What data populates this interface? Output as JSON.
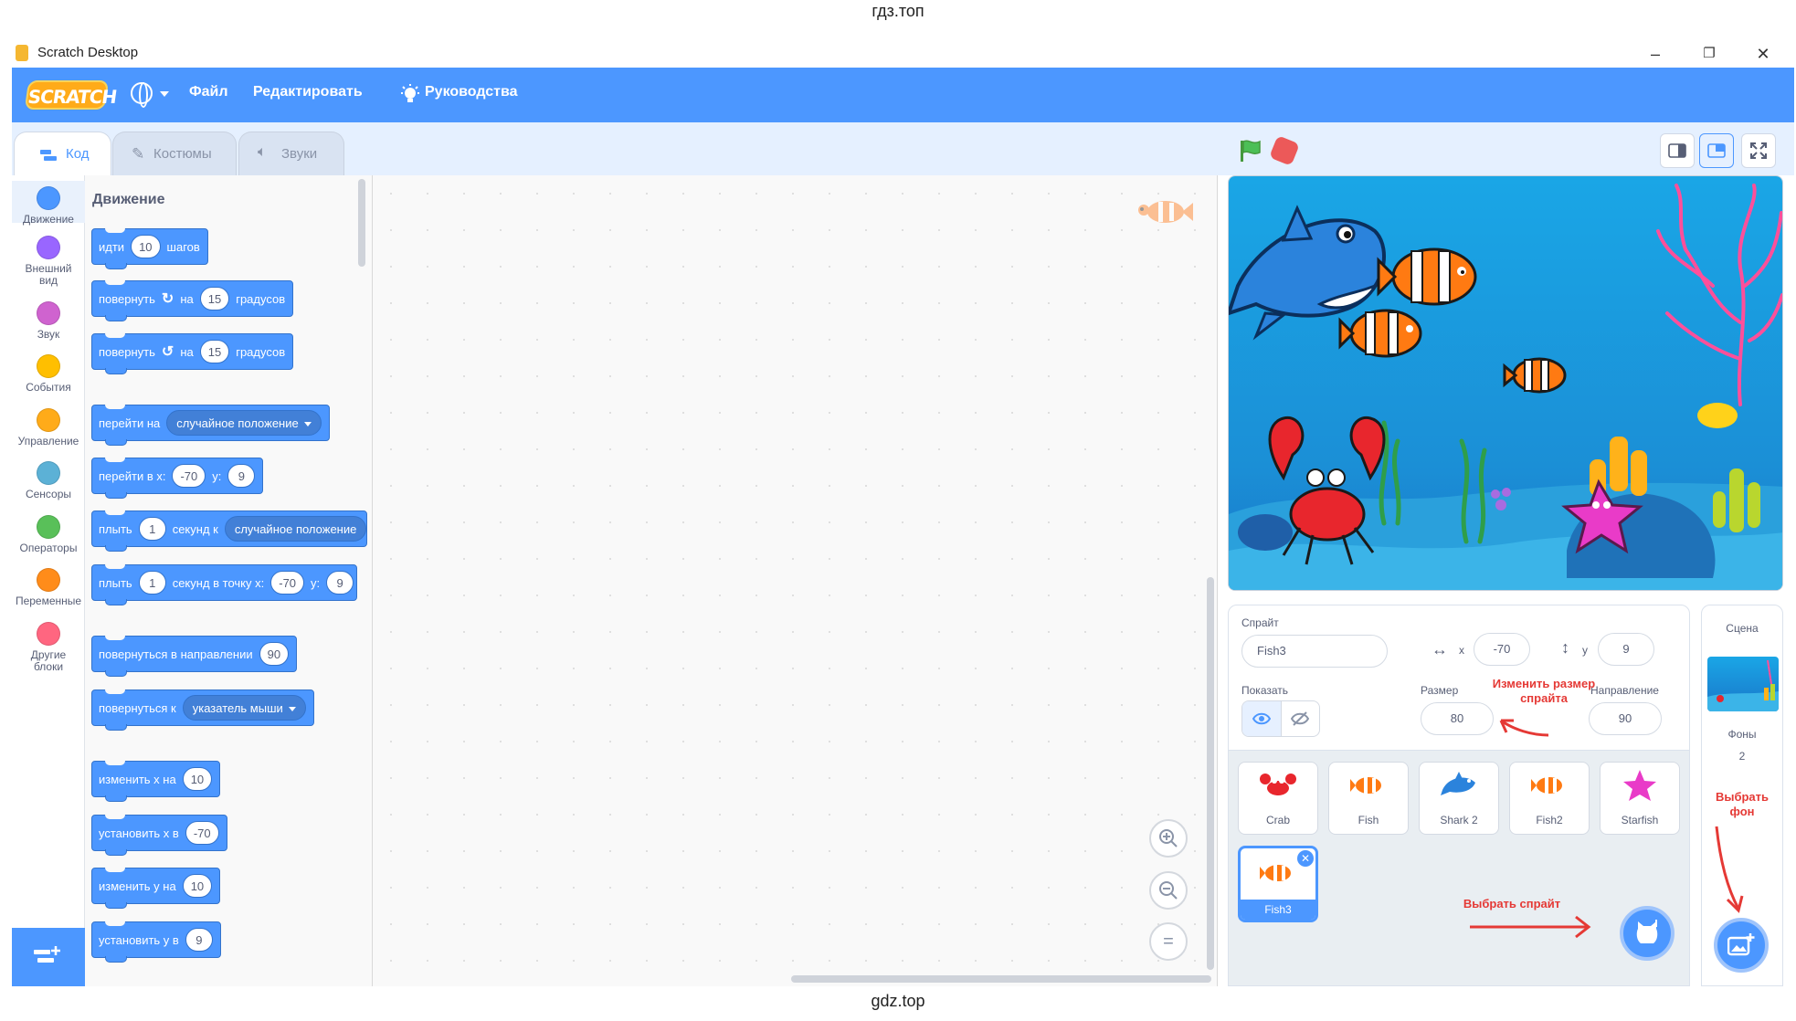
{
  "watermark_top": "гдз.топ",
  "watermark_bottom": "gdz.top",
  "window": {
    "title": "Scratch Desktop",
    "minimize": "–",
    "maximize": "❐",
    "close": "✕"
  },
  "menubar": {
    "logo": "SCRATCH",
    "file": "Файл",
    "edit": "Редактировать",
    "tutorials": "Руководства"
  },
  "tabs": {
    "code": "Код",
    "costumes": "Костюмы",
    "sounds": "Звуки"
  },
  "categories": [
    {
      "label": "Движение",
      "color": "#4c97ff"
    },
    {
      "label": "Внешний вид",
      "color": "#9966ff"
    },
    {
      "label": "Звук",
      "color": "#cf63cf"
    },
    {
      "label": "События",
      "color": "#ffbf00"
    },
    {
      "label": "Управление",
      "color": "#ffab19"
    },
    {
      "label": "Сенсоры",
      "color": "#5cb1d6"
    },
    {
      "label": "Операторы",
      "color": "#59c059"
    },
    {
      "label": "Переменные",
      "color": "#ff8c1a"
    },
    {
      "label": "Другие блоки",
      "color": "#ff6680"
    }
  ],
  "palette": {
    "section": "Движение",
    "move": {
      "a": "идти",
      "v": "10",
      "b": "шагов"
    },
    "turn_right": {
      "a": "повернуть",
      "on": "на",
      "v": "15",
      "b": "градусов"
    },
    "turn_left": {
      "a": "повернуть",
      "on": "на",
      "v": "15",
      "b": "градусов"
    },
    "goto": {
      "a": "перейти на",
      "opt": "случайное положение"
    },
    "goto_xy": {
      "a": "перейти в x:",
      "x": "-70",
      "y_label": "y:",
      "y": "9"
    },
    "glide": {
      "a": "плыть",
      "v": "1",
      "b": "секунд к",
      "opt": "случайное положение"
    },
    "glide_xy": {
      "a": "плыть",
      "v": "1",
      "b": "секунд в точку x:",
      "x": "-70",
      "y_label": "y:",
      "y": "9"
    },
    "point_dir": {
      "a": "повернуться в направлении",
      "v": "90"
    },
    "point_towards": {
      "a": "повернуться к",
      "opt": "указатель мыши"
    },
    "change_x": {
      "a": "изменить x на",
      "v": "10"
    },
    "set_x": {
      "a": "установить x в",
      "v": "-70"
    },
    "change_y": {
      "a": "изменить у на",
      "v": "10"
    },
    "set_y": {
      "a": "установить у в",
      "v": "9"
    }
  },
  "code_area": {
    "zoom_in": "+",
    "zoom_out": "−",
    "reset": "="
  },
  "sprite_info": {
    "sprite_label": "Спрайт",
    "sprite_name": "Fish3",
    "x_label": "x",
    "x": "-70",
    "y_label": "y",
    "y": "9",
    "show_label": "Показать",
    "size_label": "Размер",
    "size": "80",
    "direction_label": "Направление",
    "direction": "90"
  },
  "sprites": [
    "Crab",
    "Fish",
    "Shark 2",
    "Fish2",
    "Starfish"
  ],
  "selected_sprite": "Fish3",
  "stage_panel": {
    "label": "Сцена",
    "backdrops_label": "Фоны",
    "backdrops_count": "2"
  },
  "annotations": {
    "resize": "Изменить размер спрайта",
    "choose_sprite": "Выбрать спрайт",
    "choose_backdrop": "Выбрать фон"
  }
}
